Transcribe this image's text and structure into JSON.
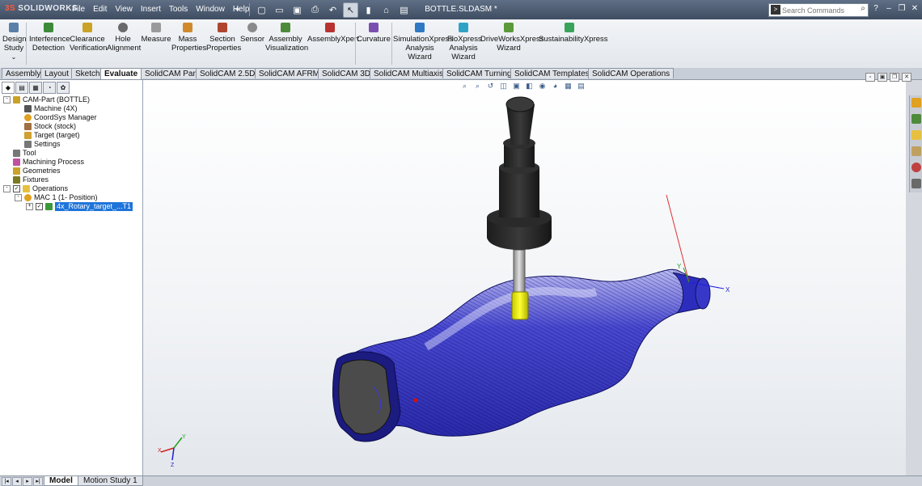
{
  "app": {
    "logo_text": "SOLIDWORKS",
    "document_title": "BOTTLE.SLDASM *"
  },
  "menu": [
    "File",
    "Edit",
    "View",
    "Insert",
    "Tools",
    "Window",
    "Help"
  ],
  "quick_access": [
    {
      "icon": "pushpin-icon"
    },
    {
      "icon": "new-document-icon"
    },
    {
      "icon": "open-folder-icon"
    },
    {
      "icon": "save-icon"
    },
    {
      "icon": "print-icon"
    },
    {
      "icon": "undo-icon"
    },
    {
      "icon": "select-arrow-icon",
      "selected": true
    },
    {
      "icon": "rebuild-icon"
    },
    {
      "icon": "file-properties-icon"
    },
    {
      "icon": "options-icon"
    }
  ],
  "search": {
    "placeholder": "Search Commands"
  },
  "command_manager": {
    "design_study": "Design\nStudy",
    "tools": [
      {
        "id": "interference-detection",
        "label": "Interference\nDetection",
        "color": "#3c8a3a"
      },
      {
        "id": "clearance-verification",
        "label": "Clearance\nVerification",
        "color": "#c9a227"
      },
      {
        "id": "hole-alignment",
        "label": "Hole\nAlignment",
        "color": "#6a6a6a"
      },
      {
        "id": "measure",
        "label": "Measure",
        "color": "#9a9a9a"
      },
      {
        "id": "mass-properties",
        "label": "Mass\nProperties",
        "color": "#d08a2c"
      },
      {
        "id": "section-properties",
        "label": "Section\nProperties",
        "color": "#b0452f"
      },
      {
        "id": "sensor",
        "label": "Sensor",
        "color": "#8a8a8a"
      },
      {
        "id": "assembly-visualization",
        "label": "Assembly\nVisualization",
        "color": "#4d8a3c"
      },
      {
        "id": "assemblyxpert",
        "label": "AssemblyXpert",
        "color": "#b8332f"
      },
      {
        "id": "curvature",
        "label": "Curvature",
        "color": "#7b4fb0"
      },
      {
        "id": "simulationxpress",
        "label": "SimulationXpress\nAnalysis Wizard",
        "color": "#2f78c4"
      },
      {
        "id": "floxpress",
        "label": "FloXpress\nAnalysis\nWizard",
        "color": "#2fa3c4"
      },
      {
        "id": "driveworksxpress",
        "label": "DriveWorksXpress\nWizard",
        "color": "#5a9a3a"
      },
      {
        "id": "sustainabilityxpress",
        "label": "SustainabilityXpress",
        "color": "#3aa35a"
      }
    ]
  },
  "tabs": [
    {
      "label": "Assembly"
    },
    {
      "label": "Layout"
    },
    {
      "label": "Sketch"
    },
    {
      "label": "Evaluate",
      "active": true
    },
    {
      "label": "SolidCAM Part"
    },
    {
      "label": "SolidCAM 2.5D"
    },
    {
      "label": "SolidCAM AFRM"
    },
    {
      "label": "SolidCAM 3D"
    },
    {
      "label": "SolidCAM Multiaxis"
    },
    {
      "label": "SolidCAM Turning"
    },
    {
      "label": "SolidCAM Templates"
    },
    {
      "label": "SolidCAM Operations"
    }
  ],
  "tree": [
    {
      "label": "CAM-Part (BOTTLE)",
      "icon": "cam-part-icon",
      "color": "#c9a227",
      "expand": "-",
      "level": 0
    },
    {
      "label": "Machine (4X)",
      "icon": "machine-icon",
      "color": "#555555",
      "level": 1
    },
    {
      "label": "CoordSys Manager",
      "icon": "coordsys-icon",
      "color": "#e0a020",
      "level": 1
    },
    {
      "label": "Stock (stock)",
      "icon": "stock-icon",
      "color": "#a07040",
      "level": 1
    },
    {
      "label": "Target (target)",
      "icon": "target-icon",
      "color": "#d0a030",
      "level": 1
    },
    {
      "label": "Settings",
      "icon": "settings-icon",
      "color": "#777777",
      "level": 1
    },
    {
      "label": "Tool",
      "icon": "tool-icon",
      "color": "#777777",
      "level": 0
    },
    {
      "label": "Machining Process",
      "icon": "machining-process-icon",
      "color": "#c050a0",
      "level": 0
    },
    {
      "label": "Geometries",
      "icon": "geometries-icon",
      "color": "#c9a227",
      "level": 0
    },
    {
      "label": "Fixtures",
      "icon": "fixtures-icon",
      "color": "#7a7a20",
      "level": 0
    },
    {
      "label": "Operations",
      "icon": "operations-folder-icon",
      "color": "#e8c040",
      "expand": "-",
      "check": true,
      "level": 0
    },
    {
      "label": "MAC 1 (1- Position)",
      "icon": "mac-icon",
      "color": "#e0a020",
      "expand": "-",
      "level": 1
    },
    {
      "label": "4x_Rotary_target_...T1",
      "icon": "operation-icon",
      "color": "#3a9a3a",
      "expand": "+",
      "check": true,
      "level": 2,
      "selected": true
    }
  ],
  "bottom_tabs": [
    {
      "label": "Model",
      "active": true
    },
    {
      "label": "Motion Study 1"
    }
  ],
  "axes": {
    "x": "X",
    "y": "Y",
    "z": "Z"
  }
}
